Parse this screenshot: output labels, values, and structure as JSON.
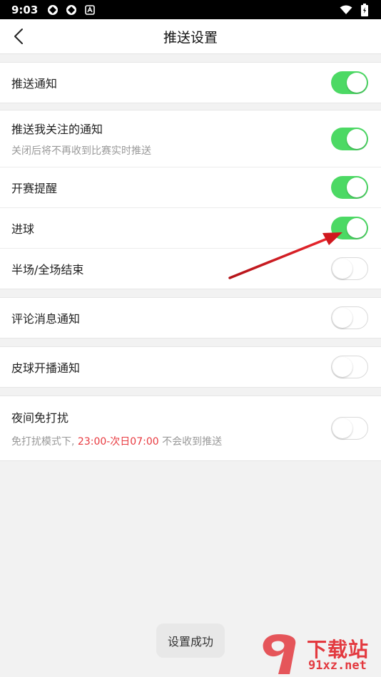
{
  "status_bar": {
    "time": "9:03"
  },
  "nav": {
    "title": "推送设置"
  },
  "groups": [
    {
      "rows": [
        {
          "label": "推送通知",
          "on": true
        }
      ]
    },
    {
      "rows": [
        {
          "label": "推送我关注的通知",
          "sub": "关闭后将不再收到比赛实时推送",
          "on": true
        },
        {
          "label": "开赛提醒",
          "on": true
        },
        {
          "label": "进球",
          "on": true
        },
        {
          "label": "半场/全场结束",
          "on": false
        }
      ]
    },
    {
      "rows": [
        {
          "label": "评论消息通知",
          "on": false
        }
      ]
    },
    {
      "rows": [
        {
          "label": "皮球开播通知",
          "on": false
        }
      ]
    },
    {
      "rows": [
        {
          "label": "夜间免打扰",
          "sub_prefix": "免打扰模式下, ",
          "sub_highlight": "23:00-次日07:00",
          "sub_suffix": " 不会收到推送",
          "on": false
        }
      ]
    }
  ],
  "toast": {
    "text": "设置成功"
  },
  "watermark": {
    "brand": "下载站",
    "url": "91xz.net"
  },
  "colors": {
    "toggle_on": "#4cd964",
    "highlight": "#e8393f",
    "annotation_arrow": "#d0181e"
  }
}
